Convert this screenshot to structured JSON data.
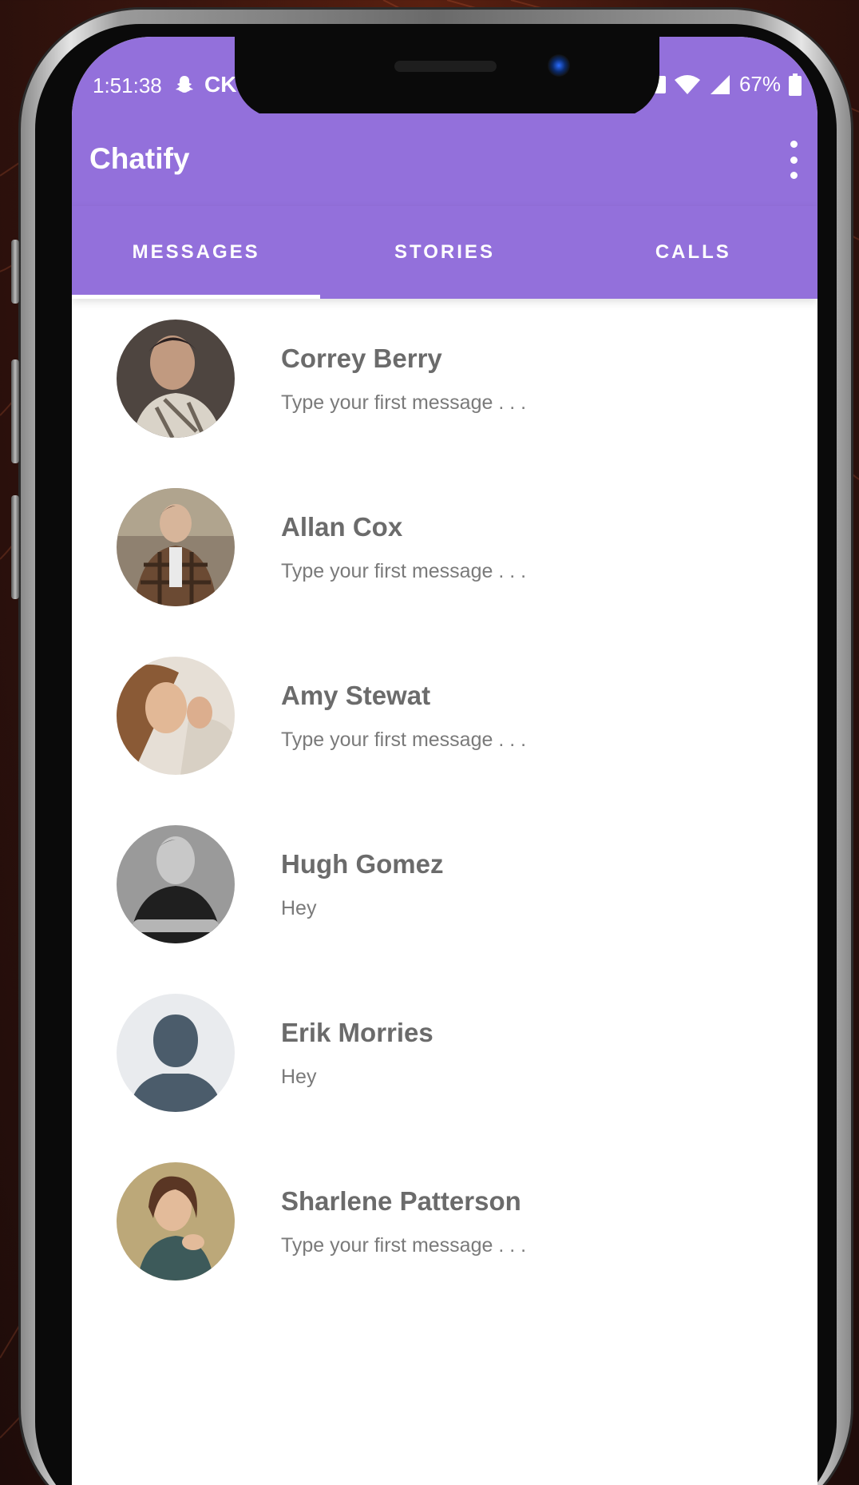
{
  "status_bar": {
    "time": "1:51:38",
    "carrier_label": "CK",
    "battery": "67%"
  },
  "app": {
    "title": "Chatify",
    "accent_color": "#9370db"
  },
  "tabs": [
    {
      "label": "MESSAGES",
      "active": true
    },
    {
      "label": "STORIES",
      "active": false
    },
    {
      "label": "CALLS",
      "active": false
    }
  ],
  "chats": [
    {
      "name": "Correy Berry",
      "preview": "Type your first message . . ."
    },
    {
      "name": "Allan Cox",
      "preview": "Type your first message . . ."
    },
    {
      "name": "Amy Stewat",
      "preview": "Type your first message . . ."
    },
    {
      "name": "Hugh Gomez",
      "preview": "Hey"
    },
    {
      "name": "Erik Morries",
      "preview": "Hey"
    },
    {
      "name": "Sharlene Patterson",
      "preview": "Type your first message . . ."
    }
  ]
}
